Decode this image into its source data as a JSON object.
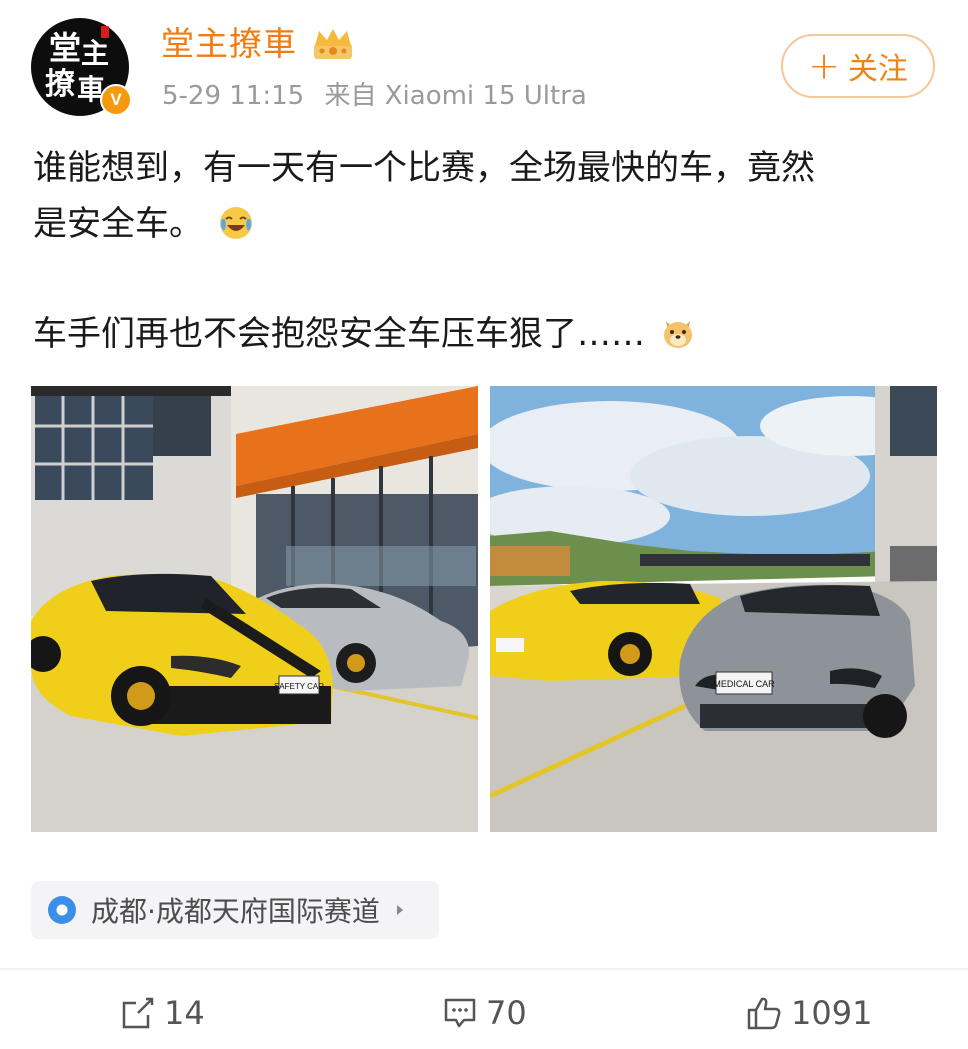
{
  "post": {
    "author": {
      "name": "堂主撩車",
      "avatar_text": "堂主撩車",
      "verified_badge": "V",
      "badge_color": "#f59a0e",
      "name_color": "#f37b0f"
    },
    "time": "5-29 11:15",
    "source": "来自 Xiaomi 15 Ultra",
    "follow_label": "关注",
    "text_line1": "谁能想到，有一天有一个比赛，全场最快的车，竟然",
    "text_line2": "是安全车。",
    "text_line3": "车手们再也不会抱怨安全车压车狠了……",
    "emoji_1": "laugh-cry-emoji",
    "emoji_2": "doge-emoji",
    "photos": [
      {
        "name": "photo-safety-car-building",
        "plate": "SAFETY CAR"
      },
      {
        "name": "photo-medical-car-track",
        "plate": "MEDICAL CAR"
      }
    ],
    "location": "成都·成都天府国际赛道",
    "actions": {
      "share_count": "14",
      "comment_count": "70",
      "like_count": "1091"
    }
  }
}
